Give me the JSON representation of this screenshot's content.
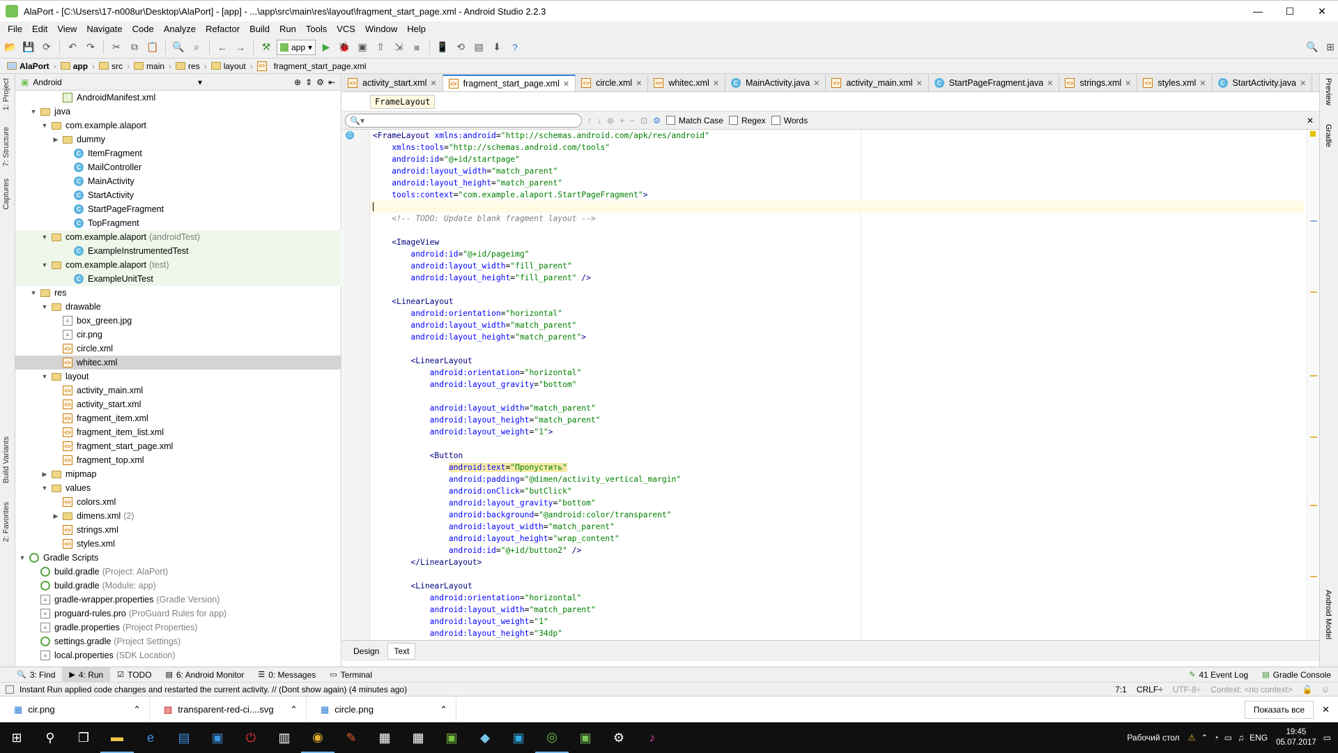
{
  "window": {
    "title": "AlaPort - [C:\\Users\\17-n008ur\\Desktop\\AlaPort] - [app] - ...\\app\\src\\main\\res\\layout\\fragment_start_page.xml - Android Studio 2.2.3"
  },
  "menu": [
    "File",
    "Edit",
    "View",
    "Navigate",
    "Code",
    "Analyze",
    "Refactor",
    "Build",
    "Run",
    "Tools",
    "VCS",
    "Window",
    "Help"
  ],
  "toolbar": {
    "config": "app"
  },
  "breadcrumbs": [
    "AlaPort",
    "app",
    "src",
    "main",
    "res",
    "layout",
    "fragment_start_page.xml"
  ],
  "project": {
    "view": "Android",
    "tree": [
      {
        "label": "AndroidManifest.xml",
        "indent": 3,
        "icon": "manifest",
        "arrow": ""
      },
      {
        "label": "java",
        "indent": 1,
        "icon": "folder",
        "arrow": "▼"
      },
      {
        "label": "com.example.alaport",
        "indent": 2,
        "icon": "folder",
        "arrow": "▼"
      },
      {
        "label": "dummy",
        "indent": 3,
        "icon": "folder",
        "arrow": "▶"
      },
      {
        "label": "ItemFragment",
        "indent": 4,
        "icon": "class",
        "arrow": ""
      },
      {
        "label": "MailController",
        "indent": 4,
        "icon": "class",
        "arrow": ""
      },
      {
        "label": "MainActivity",
        "indent": 4,
        "icon": "class",
        "arrow": ""
      },
      {
        "label": "StartActivity",
        "indent": 4,
        "icon": "class",
        "arrow": ""
      },
      {
        "label": "StartPageFragment",
        "indent": 4,
        "icon": "class",
        "arrow": ""
      },
      {
        "label": "TopFragment",
        "indent": 4,
        "icon": "class",
        "arrow": ""
      },
      {
        "label": "com.example.alaport",
        "hint": "(androidTest)",
        "indent": 2,
        "icon": "folder",
        "arrow": "▼",
        "green": true
      },
      {
        "label": "ExampleInstrumentedTest",
        "indent": 4,
        "icon": "class",
        "arrow": "",
        "green": true
      },
      {
        "label": "com.example.alaport",
        "hint": "(test)",
        "indent": 2,
        "icon": "folder",
        "arrow": "▼",
        "green": true
      },
      {
        "label": "ExampleUnitTest",
        "indent": 4,
        "icon": "class",
        "arrow": "",
        "green": true
      },
      {
        "label": "res",
        "indent": 1,
        "icon": "folder",
        "arrow": "▼"
      },
      {
        "label": "drawable",
        "indent": 2,
        "icon": "folder",
        "arrow": "▼"
      },
      {
        "label": "box_green.jpg",
        "indent": 3,
        "icon": "file",
        "arrow": ""
      },
      {
        "label": "cir.png",
        "indent": 3,
        "icon": "file",
        "arrow": ""
      },
      {
        "label": "circle.xml",
        "indent": 3,
        "icon": "xml",
        "arrow": ""
      },
      {
        "label": "whitec.xml",
        "indent": 3,
        "icon": "xml",
        "arrow": "",
        "sel": true
      },
      {
        "label": "layout",
        "indent": 2,
        "icon": "folder",
        "arrow": "▼"
      },
      {
        "label": "activity_main.xml",
        "indent": 3,
        "icon": "xml",
        "arrow": ""
      },
      {
        "label": "activity_start.xml",
        "indent": 3,
        "icon": "xml",
        "arrow": ""
      },
      {
        "label": "fragment_item.xml",
        "indent": 3,
        "icon": "xml",
        "arrow": ""
      },
      {
        "label": "fragment_item_list.xml",
        "indent": 3,
        "icon": "xml",
        "arrow": ""
      },
      {
        "label": "fragment_start_page.xml",
        "indent": 3,
        "icon": "xml",
        "arrow": ""
      },
      {
        "label": "fragment_top.xml",
        "indent": 3,
        "icon": "xml",
        "arrow": ""
      },
      {
        "label": "mipmap",
        "indent": 2,
        "icon": "folder",
        "arrow": "▶"
      },
      {
        "label": "values",
        "indent": 2,
        "icon": "folder",
        "arrow": "▼"
      },
      {
        "label": "colors.xml",
        "indent": 3,
        "icon": "xml",
        "arrow": ""
      },
      {
        "label": "dimens.xml",
        "hint": "(2)",
        "indent": 3,
        "icon": "folder",
        "arrow": "▶"
      },
      {
        "label": "strings.xml",
        "indent": 3,
        "icon": "xml",
        "arrow": ""
      },
      {
        "label": "styles.xml",
        "indent": 3,
        "icon": "xml",
        "arrow": ""
      },
      {
        "label": "Gradle Scripts",
        "indent": 0,
        "icon": "gradle",
        "arrow": "▼"
      },
      {
        "label": "build.gradle",
        "hint": "(Project: AlaPort)",
        "indent": 1,
        "icon": "gradle",
        "arrow": ""
      },
      {
        "label": "build.gradle",
        "hint": "(Module: app)",
        "indent": 1,
        "icon": "gradle",
        "arrow": ""
      },
      {
        "label": "gradle-wrapper.properties",
        "hint": "(Gradle Version)",
        "indent": 1,
        "icon": "file",
        "arrow": ""
      },
      {
        "label": "proguard-rules.pro",
        "hint": "(ProGuard Rules for app)",
        "indent": 1,
        "icon": "file",
        "arrow": ""
      },
      {
        "label": "gradle.properties",
        "hint": "(Project Properties)",
        "indent": 1,
        "icon": "file",
        "arrow": ""
      },
      {
        "label": "settings.gradle",
        "hint": "(Project Settings)",
        "indent": 1,
        "icon": "gradle",
        "arrow": ""
      },
      {
        "label": "local.properties",
        "hint": "(SDK Location)",
        "indent": 1,
        "icon": "file",
        "arrow": ""
      }
    ]
  },
  "tabs": [
    {
      "label": "activity_start.xml",
      "icon": "xml"
    },
    {
      "label": "fragment_start_page.xml",
      "icon": "xml",
      "active": true
    },
    {
      "label": "circle.xml",
      "icon": "xml"
    },
    {
      "label": "whitec.xml",
      "icon": "xml"
    },
    {
      "label": "MainActivity.java",
      "icon": "class"
    },
    {
      "label": "activity_main.xml",
      "icon": "xml"
    },
    {
      "label": "StartPageFragment.java",
      "icon": "class"
    },
    {
      "label": "strings.xml",
      "icon": "xml"
    },
    {
      "label": "styles.xml",
      "icon": "xml"
    },
    {
      "label": "StartActivity.java",
      "icon": "class"
    }
  ],
  "editor": {
    "crumb": "FrameLayout",
    "search": {
      "match_case": "Match Case",
      "regex": "Regex",
      "words": "Words"
    },
    "lines": [
      [
        [
          "tag",
          "<FrameLayout "
        ],
        [
          "attr",
          "xmlns:android"
        ],
        [
          "",
          "="
        ],
        [
          "val",
          "\"http://schemas.android.com/apk/res/android\""
        ]
      ],
      [
        [
          "",
          "    "
        ],
        [
          "attr",
          "xmlns:tools"
        ],
        [
          "",
          "="
        ],
        [
          "val",
          "\"http://schemas.android.com/tools\""
        ]
      ],
      [
        [
          "",
          "    "
        ],
        [
          "attr",
          "android:id"
        ],
        [
          "",
          "="
        ],
        [
          "val",
          "\"@+id/startpage\""
        ]
      ],
      [
        [
          "",
          "    "
        ],
        [
          "attr",
          "android:layout_width"
        ],
        [
          "",
          "="
        ],
        [
          "val",
          "\"match_parent\""
        ]
      ],
      [
        [
          "",
          "    "
        ],
        [
          "attr",
          "android:layout_height"
        ],
        [
          "",
          "="
        ],
        [
          "val",
          "\"match_parent\""
        ]
      ],
      [
        [
          "",
          "    "
        ],
        [
          "attr",
          "tools:context"
        ],
        [
          "",
          "="
        ],
        [
          "val",
          "\"com.example.alaport.StartPageFragment\""
        ],
        [
          "tag",
          ">"
        ]
      ],
      [
        [
          "",
          ""
        ]
      ],
      [
        [
          "",
          "    "
        ],
        [
          "cmt",
          "<!-- TODO: Update blank fragment layout -->"
        ]
      ],
      [
        [
          "",
          ""
        ]
      ],
      [
        [
          "",
          "    "
        ],
        [
          "tag",
          "<ImageView"
        ]
      ],
      [
        [
          "",
          "        "
        ],
        [
          "attr",
          "android:id"
        ],
        [
          "",
          "="
        ],
        [
          "val",
          "\"@+id/pageimg\""
        ]
      ],
      [
        [
          "",
          "        "
        ],
        [
          "attr",
          "android:layout_width"
        ],
        [
          "",
          "="
        ],
        [
          "val",
          "\"fill_parent\""
        ]
      ],
      [
        [
          "",
          "        "
        ],
        [
          "attr",
          "android:layout_height"
        ],
        [
          "",
          "="
        ],
        [
          "val",
          "\"fill_parent\""
        ],
        [
          "tag",
          " />"
        ]
      ],
      [
        [
          "",
          ""
        ]
      ],
      [
        [
          "",
          "    "
        ],
        [
          "tag",
          "<LinearLayout"
        ]
      ],
      [
        [
          "",
          "        "
        ],
        [
          "attr",
          "android:orientation"
        ],
        [
          "",
          "="
        ],
        [
          "val",
          "\"horizontal\""
        ]
      ],
      [
        [
          "",
          "        "
        ],
        [
          "attr",
          "android:layout_width"
        ],
        [
          "",
          "="
        ],
        [
          "val",
          "\"match_parent\""
        ]
      ],
      [
        [
          "",
          "        "
        ],
        [
          "attr",
          "android:layout_height"
        ],
        [
          "",
          "="
        ],
        [
          "val",
          "\"match_parent\""
        ],
        [
          "tag",
          ">"
        ]
      ],
      [
        [
          "",
          ""
        ]
      ],
      [
        [
          "",
          "        "
        ],
        [
          "tag",
          "<LinearLayout"
        ]
      ],
      [
        [
          "",
          "            "
        ],
        [
          "attr",
          "android:orientation"
        ],
        [
          "",
          "="
        ],
        [
          "val",
          "\"horizontal\""
        ]
      ],
      [
        [
          "",
          "            "
        ],
        [
          "attr",
          "android:layout_gravity"
        ],
        [
          "",
          "="
        ],
        [
          "val",
          "\"bottom\""
        ]
      ],
      [
        [
          "",
          ""
        ]
      ],
      [
        [
          "",
          "            "
        ],
        [
          "attr",
          "android:layout_width"
        ],
        [
          "",
          "="
        ],
        [
          "val",
          "\"match_parent\""
        ]
      ],
      [
        [
          "",
          "            "
        ],
        [
          "attr",
          "android:layout_height"
        ],
        [
          "",
          "="
        ],
        [
          "val",
          "\"match_parent\""
        ]
      ],
      [
        [
          "",
          "            "
        ],
        [
          "attr",
          "android:layout_weight"
        ],
        [
          "",
          "="
        ],
        [
          "val",
          "\"1\""
        ],
        [
          "tag",
          ">"
        ]
      ],
      [
        [
          "",
          ""
        ]
      ],
      [
        [
          "",
          "            "
        ],
        [
          "tag",
          "<Button"
        ]
      ],
      [
        [
          "",
          "                "
        ],
        [
          "attr hl",
          "android:text"
        ],
        [
          "hl",
          "="
        ],
        [
          "val hl",
          "\"Пропустить\""
        ]
      ],
      [
        [
          "",
          "                "
        ],
        [
          "attr",
          "android:padding"
        ],
        [
          "",
          "="
        ],
        [
          "val",
          "\"@dimen/activity_vertical_margin\""
        ]
      ],
      [
        [
          "",
          "                "
        ],
        [
          "attr",
          "android:onClick"
        ],
        [
          "",
          "="
        ],
        [
          "val",
          "\"butClick\""
        ]
      ],
      [
        [
          "",
          "                "
        ],
        [
          "attr",
          "android:layout_gravity"
        ],
        [
          "",
          "="
        ],
        [
          "val",
          "\"bottom\""
        ]
      ],
      [
        [
          "",
          "                "
        ],
        [
          "attr",
          "android:background"
        ],
        [
          "",
          "="
        ],
        [
          "val",
          "\"@android:color/transparent\""
        ]
      ],
      [
        [
          "",
          "                "
        ],
        [
          "attr",
          "android:layout_width"
        ],
        [
          "",
          "="
        ],
        [
          "val",
          "\"match_parent\""
        ]
      ],
      [
        [
          "",
          "                "
        ],
        [
          "attr",
          "android:layout_height"
        ],
        [
          "",
          "="
        ],
        [
          "val",
          "\"wrap_content\""
        ]
      ],
      [
        [
          "",
          "                "
        ],
        [
          "attr",
          "android:id"
        ],
        [
          "",
          "="
        ],
        [
          "val",
          "\"@+id/button2\""
        ],
        [
          "tag",
          " />"
        ]
      ],
      [
        [
          "",
          "        "
        ],
        [
          "tag",
          "</LinearLayout>"
        ]
      ],
      [
        [
          "",
          ""
        ]
      ],
      [
        [
          "",
          "        "
        ],
        [
          "tag",
          "<LinearLayout"
        ]
      ],
      [
        [
          "",
          "            "
        ],
        [
          "attr",
          "android:orientation"
        ],
        [
          "",
          "="
        ],
        [
          "val",
          "\"horizontal\""
        ]
      ],
      [
        [
          "",
          "            "
        ],
        [
          "attr",
          "android:layout_width"
        ],
        [
          "",
          "="
        ],
        [
          "val",
          "\"match_parent\""
        ]
      ],
      [
        [
          "",
          "            "
        ],
        [
          "attr",
          "android:layout_weight"
        ],
        [
          "",
          "="
        ],
        [
          "val",
          "\"1\""
        ]
      ],
      [
        [
          "",
          "            "
        ],
        [
          "attr",
          "android:layout_height"
        ],
        [
          "",
          "="
        ],
        [
          "val",
          "\"34dp\""
        ]
      ]
    ],
    "bottom_tabs": [
      "Design",
      "Text"
    ]
  },
  "left_strip": [
    "1: Project",
    "7: Structure",
    "Captures",
    "Build Variants",
    "2: Favorites"
  ],
  "right_strip": [
    "Preview",
    "Gradle",
    "Android Model"
  ],
  "tool_windows": [
    {
      "label": "3: Find"
    },
    {
      "label": "4: Run",
      "on": true
    },
    {
      "label": "TODO"
    },
    {
      "label": "6: Android Monitor"
    },
    {
      "label": "0: Messages"
    },
    {
      "label": "Terminal"
    }
  ],
  "tool_right": [
    "41 Event Log",
    "Gradle Console"
  ],
  "status": {
    "message": "Instant Run applied code changes and restarted the current activity. // (Dont show again) (4 minutes ago)",
    "position": "7:1",
    "crlf": "CRLF÷",
    "encoding": "UTF-8÷",
    "context": "Context: <no context>"
  },
  "downloads": {
    "items": [
      "cir.png",
      "transparent-red-ci....svg",
      "circle.png"
    ],
    "show_all": "Показать все"
  },
  "taskbar": {
    "desktop": "Рабочий стол",
    "lang": "ENG",
    "time": "19:45",
    "date": "05.07.2017"
  }
}
